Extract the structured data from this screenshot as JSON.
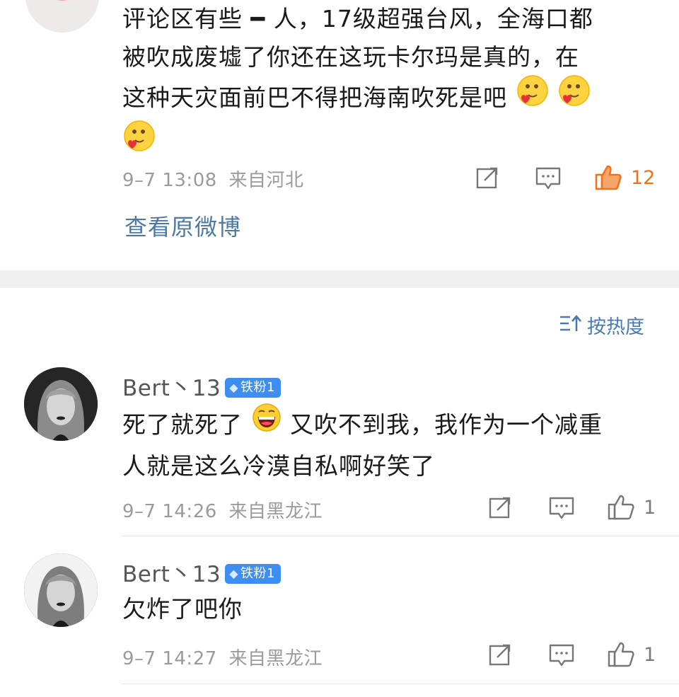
{
  "comments": [
    {
      "text_lines": [
        "评论区有些 ━ 人，17级超强台风，全海口都",
        "被吹成废墟了你还在这玩卡尔玛是真的，在",
        "这种天灾面前巴不得把海南吹死是吧"
      ],
      "time": "9–7 13:08",
      "location": "来自河北",
      "likes": "12",
      "liked": true
    },
    {
      "username": "Bert丶13",
      "badge": "铁粉1",
      "text_line1a": "死了就死了",
      "text_line1b": "又吹不到我，我作为一个减重",
      "text_line2": "人就是这么冷漠自私啊好笑了",
      "time": "9–7 14:26",
      "location": "来自黑龙江",
      "likes": "1",
      "liked": false
    },
    {
      "username": "Bert丶13",
      "badge": "铁粉1",
      "text": "欠炸了吧你",
      "time": "9–7 14:27",
      "location": "来自黑龙江",
      "likes": "1",
      "liked": false
    }
  ],
  "view_original": "查看原微博",
  "sort_label": "按热度",
  "colors": {
    "link": "#4d78a6",
    "like_active": "#f0721d",
    "badge": "#3d8ef0"
  }
}
